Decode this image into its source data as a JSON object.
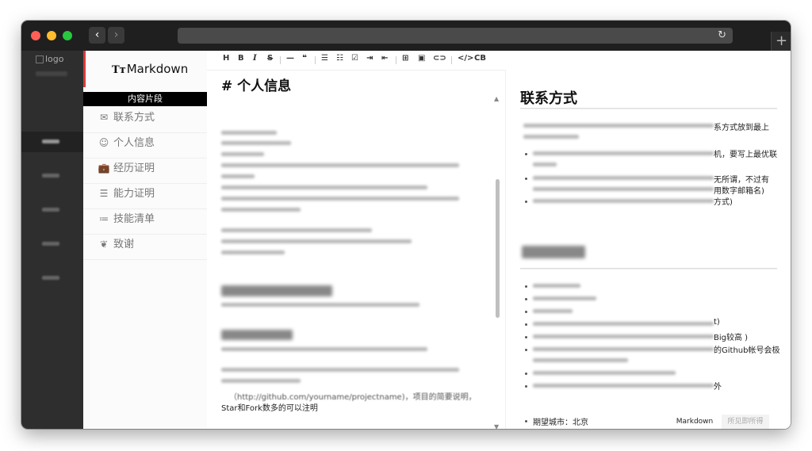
{
  "browser": {
    "back_glyph": "‹",
    "forward_glyph": "›",
    "reload_glyph": "↻",
    "new_tab_glyph": "+"
  },
  "rail": {
    "logo_alt": "logo"
  },
  "sidebar": {
    "brand_prefix": "Tт",
    "brand_name": "Markdown",
    "section_header": "内容片段",
    "items": [
      {
        "label": "联系方式",
        "icon": "✉",
        "icon_name": "envelope-icon"
      },
      {
        "label": "个人信息",
        "icon": "☺",
        "icon_name": "smiley-icon"
      },
      {
        "label": "经历证明",
        "icon": "💼",
        "icon_name": "briefcase-icon"
      },
      {
        "label": "能力证明",
        "icon": "☰",
        "icon_name": "ability-icon"
      },
      {
        "label": "技能清单",
        "icon": "≔",
        "icon_name": "list-icon"
      },
      {
        "label": "致谢",
        "icon": "❦",
        "icon_name": "thanks-icon"
      }
    ]
  },
  "toolbar": {
    "buttons": [
      "H",
      "B",
      "I",
      "S",
      "—",
      "❝",
      "☰",
      "☷",
      "☑",
      "⇥",
      "⇤",
      "⊞",
      "▣",
      "⊂⊃",
      "</>",
      "CB"
    ]
  },
  "editor": {
    "heading": "# 个人信息",
    "link_line": "（http://github.com/yourname/projectname)，项目的简要说明，",
    "last_line": "Star和Fork数多的可以注明"
  },
  "preview": {
    "heading": "联系方式",
    "frag_1": "系方式放到最上",
    "frag_2": "机，要写上最优联",
    "frag_3": "无所谓，不过有",
    "frag_4": "用数字邮箱名)",
    "frag_5": "方式)",
    "frag_6": "t)",
    "frag_7": "Big较高 )",
    "frag_8": "的Github帐号会极",
    "frag_9": "外",
    "last_bullet": "期望城市：北京"
  },
  "bottom_tabs": {
    "active": "Markdown",
    "inactive": "所见即所得"
  }
}
